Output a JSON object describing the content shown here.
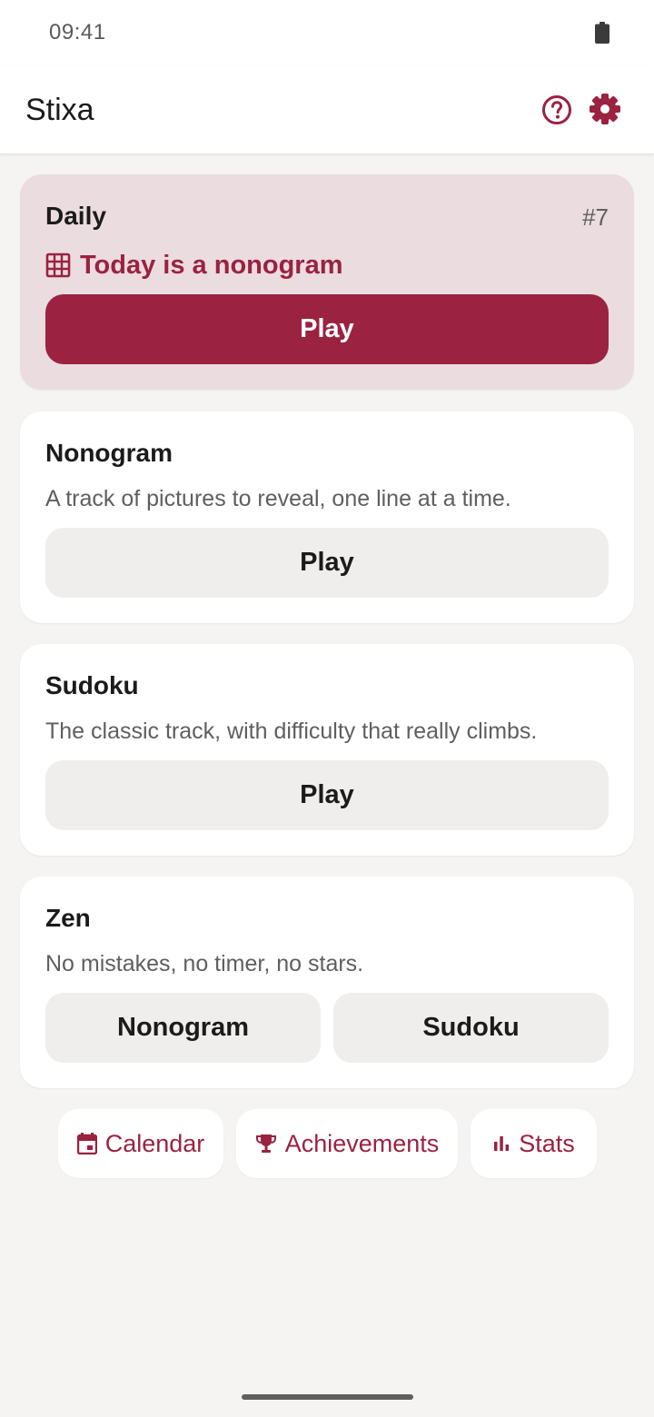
{
  "status_bar": {
    "time": "09:41",
    "battery_icon": "battery-full-icon"
  },
  "app_bar": {
    "title": "Stixa",
    "help_icon": "help-circle-icon",
    "settings_icon": "gear-icon"
  },
  "daily": {
    "title": "Daily",
    "number": "#7",
    "subtitle": "Today is a nonogram",
    "subtitle_icon": "grid-icon",
    "play_label": "Play"
  },
  "nonogram": {
    "title": "Nonogram",
    "description": "A track of pictures to reveal, one line at a time.",
    "play_label": "Play"
  },
  "sudoku": {
    "title": "Sudoku",
    "description": "The classic track, with difficulty that really climbs.",
    "play_label": "Play"
  },
  "zen": {
    "title": "Zen",
    "description": "No mistakes, no timer, no stars.",
    "buttons": [
      "Nonogram",
      "Sudoku"
    ]
  },
  "bottom_links": [
    {
      "label": "Calendar",
      "icon": "calendar-icon"
    },
    {
      "label": "Achievements",
      "icon": "trophy-icon"
    },
    {
      "label": "Stats",
      "icon": "bar-chart-icon"
    }
  ],
  "colors": {
    "accent": "#9b2240",
    "daily_card_bg": "#eadcdf",
    "background": "#f5f4f3",
    "secondary_button": "#efeeed"
  }
}
